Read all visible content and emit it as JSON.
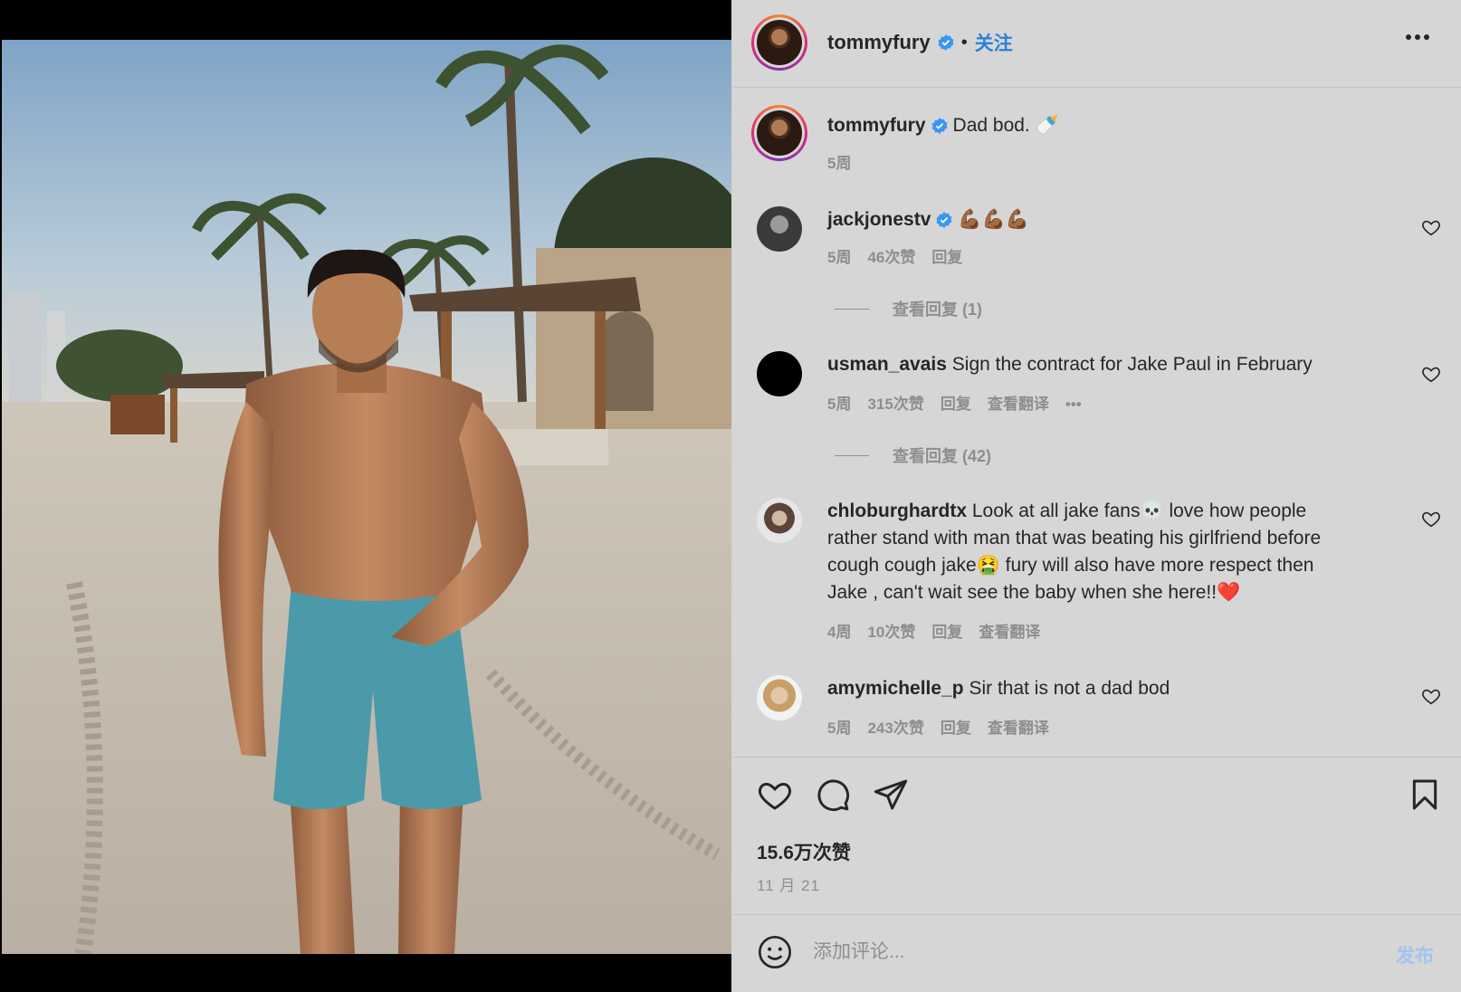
{
  "post": {
    "author": "tommyfury",
    "follow_label": "关注",
    "separator": "•",
    "caption_author": "tommyfury",
    "caption": "Dad bod. 🍼",
    "caption_time": "5周"
  },
  "comments": [
    {
      "username": "jackjonestv",
      "verified": true,
      "text": "💪🏾💪🏾💪🏾",
      "time": "5周",
      "likes": "46次赞",
      "reply": "回复",
      "view_replies": "查看回复 (1)"
    },
    {
      "username": "usman_avais",
      "text": "Sign the contract for Jake Paul in February",
      "time": "5周",
      "likes": "315次赞",
      "reply": "回复",
      "translate": "查看翻译",
      "more": "•••",
      "view_replies": "查看回复 (42)"
    },
    {
      "username": "chloburghardtx",
      "text_line1": "Look at all jake fans💀 love how people",
      "text_line2": "rather stand with man that was beating his girlfriend before",
      "text_line3": "cough cough jake🤮 fury will also have more respect then",
      "text_line4": "Jake , can't wait see the baby when she here!!❤️",
      "time": "4周",
      "likes": "10次赞",
      "reply": "回复",
      "translate": "查看翻译"
    },
    {
      "username": "amymichelle_p",
      "text": "Sir that is not a dad bod",
      "time": "5周",
      "likes": "243次赞",
      "reply": "回复",
      "translate": "查看翻译"
    }
  ],
  "actions": {
    "likes_count": "15.6万次赞",
    "date": "11 月 21"
  },
  "comment_box": {
    "placeholder": "添加评论...",
    "post_label": "发布"
  },
  "icons": {
    "heart": "heart-icon",
    "comment": "comment-icon",
    "share": "share-icon",
    "save": "bookmark-icon",
    "emoji": "emoji-icon",
    "more": "more-options-icon",
    "verified": "verified-badge-icon"
  },
  "colors": {
    "panel_bg": "#d6d6d6",
    "link_blue": "#2f7fd8",
    "verified_blue": "#3897f0",
    "muted_text": "#8e8e8e",
    "post_button_disabled": "#9fc5ef"
  }
}
